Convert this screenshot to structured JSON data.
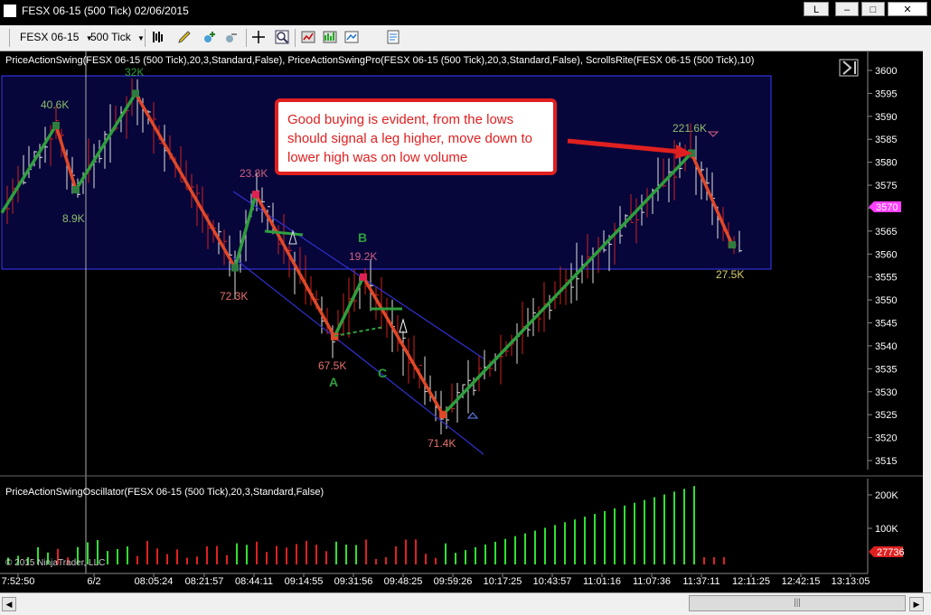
{
  "window": {
    "title": "FESX 06-15 (500 Tick)  02/06/2015",
    "buttons": [
      "L",
      "–",
      "□",
      "✕"
    ]
  },
  "toolbar": {
    "instrument": "FESX 06-15",
    "interval": "500 Tick",
    "icons": [
      "bar-type-icon",
      "draw-pencil-icon",
      "crosshair-plus-icon",
      "crosshair-minus-icon",
      "crosshair-icon",
      "zoom-icon",
      "strategy-icon",
      "indicator-icon",
      "chart-properties-icon",
      "data-box-icon"
    ]
  },
  "indicator_label": "PriceActionSwing(FESX 06-15 (500 Tick),20,3,Standard,False), PriceActionSwingPro(FESX 06-15 (500 Tick),20,3,Standard,False), ScrollsRite(FESX 06-15 (500 Tick),10)",
  "oscillator_label": "PriceActionSwingOscillator(FESX 06-15 (500 Tick),20,3,Standard,False)",
  "copyright": "© 2015 NinjaTrader, LLC",
  "callout_text": "Good buying is evident, from the lows should signal a leg higher, move down to lower high was on low volume",
  "current_price": "3570",
  "oscillator_value": "27736",
  "colors": {
    "up_swing": "#2e9e3e",
    "down_swing": "#e04828",
    "zone_fill": "#06063a",
    "zone_border": "#3a3aff",
    "label_green": "#8fbc6e",
    "label_pink": "#d06080",
    "price_marker": "#ff40ff",
    "osc_marker": "#e02020"
  },
  "chart_data": {
    "type": "line",
    "title": "",
    "price_axis": {
      "ticks": [
        3600,
        3595,
        3590,
        3585,
        3580,
        3575,
        3570,
        3565,
        3560,
        3555,
        3550,
        3545,
        3540,
        3535,
        3530,
        3525,
        3520,
        3515
      ]
    },
    "time_axis": {
      "ticks": [
        "7:52:50",
        "6/2",
        "08:05:24",
        "08:21:57",
        "08:44:11",
        "09:14:55",
        "09:31:56",
        "09:48:25",
        "09:59:26",
        "10:17:25",
        "10:43:57",
        "11:01:16",
        "11:07:36",
        "11:37:11",
        "12:11:25",
        "12:42:15",
        "13:13:05"
      ]
    },
    "swing_points": [
      {
        "label": "",
        "price": 3569
      },
      {
        "label": "40.6K",
        "price": 3588
      },
      {
        "label": "8.9K",
        "price": 3574
      },
      {
        "label": "32K",
        "price": 3595
      },
      {
        "label": "72.3K",
        "price": 3557
      },
      {
        "label": "23.8K",
        "price": 3573
      },
      {
        "label": "67.5K",
        "price": 3542
      },
      {
        "label": "19.2K",
        "price": 3555
      },
      {
        "label": "71.4K",
        "price": 3525
      },
      {
        "label": "221.6K",
        "price": 3582
      },
      {
        "label": "27.5K",
        "price": 3562
      }
    ],
    "annotations": [
      "A",
      "B",
      "C"
    ],
    "oscillator_axis": {
      "ticks": [
        "200K",
        "100K"
      ]
    }
  }
}
